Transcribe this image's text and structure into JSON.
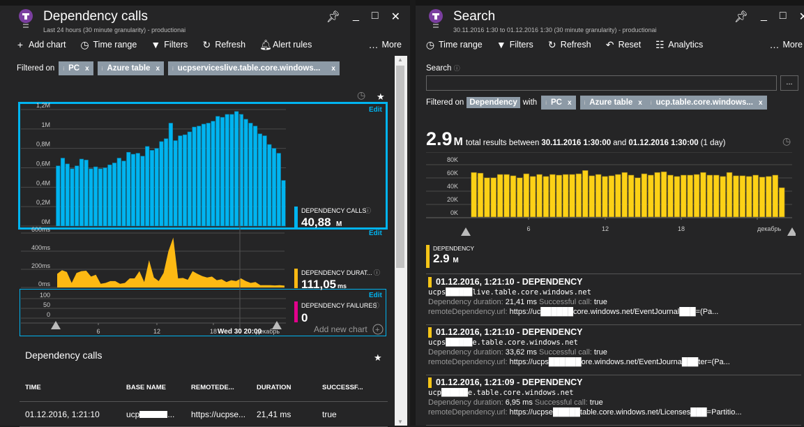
{
  "left": {
    "title": "Dependency calls",
    "subtitle": "Last 24 hours (30 minute granularity) - productionai",
    "toolbar": [
      "Add chart",
      "Time range",
      "Filters",
      "Refresh",
      "Alert rules"
    ],
    "more": "More",
    "filter_label": "Filtered on",
    "filters": [
      "PC",
      "Azure table",
      "ucpserviceslive.table.core.windows..."
    ],
    "edit": "Edit",
    "add_chart": "Add new chart",
    "metrics": [
      {
        "label": "DEPENDENCY CALLS",
        "value": "40,88",
        "unit": "M",
        "color": "#00b4f0"
      },
      {
        "label": "DEPENDENCY DURAT...",
        "value": "111,05",
        "unit": "ms",
        "color": "#fdb913"
      },
      {
        "label": "DEPENDENCY FAILURES",
        "value": "0",
        "unit": "",
        "color": "#e3008c"
      }
    ],
    "hover_label": "Wed 30 20:00",
    "section_title": "Dependency calls",
    "table": {
      "columns": [
        "TIME",
        "BASE NAME",
        "REMOTEDE...",
        "DURATION",
        "SUCCESSF..."
      ],
      "rows": [
        [
          "01.12.2016, 1:21:10",
          "ucp",
          "https://ucpse...",
          "21,41 ms",
          "true"
        ]
      ]
    }
  },
  "right": {
    "title": "Search",
    "subtitle": "30.11.2016 1:30 to 01.12.2016 1:30 (30 minute granularity) - productionai",
    "toolbar": [
      "Time range",
      "Filters",
      "Refresh",
      "Reset",
      "Analytics"
    ],
    "more": "More",
    "search_label": "Search",
    "search_value": "",
    "dots": "...",
    "filter_label": "Filtered on",
    "filter_type": "Dependency",
    "with": "with",
    "filters": [
      "PC",
      "Azure table",
      "ucp.table.core.windows..."
    ],
    "total_value": "2.9",
    "total_unit": "M",
    "total_text": "total results between",
    "from": "30.11.2016 1:30:00",
    "and": "and",
    "to": "01.12.2016 1:30:00",
    "span": "(1 day)",
    "summary": {
      "label": "DEPENDENCY",
      "value": "2.9",
      "unit": "M"
    },
    "results": [
      {
        "title": "01.12.2016, 1:21:10 - DEPENDENCY",
        "target": "ucps██████live.table.core.windows.net",
        "duration": "21,41 ms",
        "success": "true",
        "url": "https://uc██████core.windows.net/EventJournal███=(Pa..."
      },
      {
        "title": "01.12.2016, 1:21:10 - DEPENDENCY",
        "target": "ucps██████e.table.core.windows.net",
        "duration": "33,62 ms",
        "success": "true",
        "url": "https://ucps██████ore.windows.net/EventJourna███ter=(Pa..."
      },
      {
        "title": "01.12.2016, 1:21:09 - DEPENDENCY",
        "target": "ucp██████e.table.core.windows.net",
        "duration": "6,95 ms",
        "success": "true",
        "url": "https://ucpse█████table.core.windows.net/Licenses███=Partitio..."
      }
    ],
    "duration_key": "Dependency duration:",
    "success_key": "Successful call:",
    "url_key": "remoteDependency.url:"
  },
  "chart_data": [
    {
      "type": "bar",
      "title": "Dependency calls",
      "ylabel": "",
      "yticks": [
        "0M",
        "0,2M",
        "0,4M",
        "0,6M",
        "0,8M",
        "1M",
        "1,2M"
      ],
      "ylim": [
        0,
        1.2
      ],
      "xticks": [
        "6",
        "12",
        "18",
        "декабрь"
      ],
      "values": [
        0.62,
        0.7,
        0.64,
        0.59,
        0.62,
        0.69,
        0.68,
        0.59,
        0.61,
        0.59,
        0.6,
        0.63,
        0.65,
        0.7,
        0.67,
        0.76,
        0.74,
        0.75,
        0.72,
        0.82,
        0.78,
        0.8,
        0.87,
        0.9,
        1.06,
        0.88,
        0.93,
        0.94,
        0.97,
        1.02,
        1.03,
        1.05,
        1.06,
        1.08,
        1.13,
        1.12,
        1.15,
        1.15,
        1.18,
        1.15,
        1.1,
        1.06,
        1.03,
        0.95,
        0.93,
        0.84,
        0.8,
        0.75,
        0.47
      ]
    },
    {
      "type": "area",
      "title": "Dependency duration",
      "yticks": [
        "0ms",
        "200ms",
        "400ms",
        "600ms"
      ],
      "ylim": [
        0,
        600
      ],
      "values": [
        150,
        190,
        170,
        50,
        160,
        180,
        185,
        120,
        140,
        40,
        50,
        70,
        70,
        40,
        50,
        100,
        100,
        180,
        60,
        300,
        110,
        70,
        160,
        400,
        550,
        100,
        105,
        85,
        180,
        150,
        125,
        110,
        120,
        80,
        90,
        60,
        80,
        70,
        100,
        70,
        50,
        60,
        25,
        25,
        25,
        22,
        25,
        20
      ]
    },
    {
      "type": "line",
      "title": "Dependency failures",
      "yticks": [
        "0",
        "50",
        "100"
      ],
      "ylim": [
        0,
        100
      ],
      "values": []
    },
    {
      "type": "bar",
      "title": "Search results",
      "yticks": [
        "0K",
        "20K",
        "40K",
        "60K",
        "80K"
      ],
      "ylim": [
        0,
        80
      ],
      "xticks": [
        "6",
        "12",
        "18",
        "декабрь"
      ],
      "values": [
        64,
        63,
        56,
        56,
        61,
        61,
        59,
        56,
        62,
        58,
        61,
        58,
        61,
        60,
        61,
        61,
        62,
        67,
        59,
        61,
        58,
        59,
        61,
        64,
        60,
        56,
        62,
        60,
        64,
        65,
        60,
        58,
        60,
        60,
        61,
        64,
        60,
        60,
        58,
        64,
        59,
        59,
        58,
        60,
        57,
        58,
        60,
        41
      ]
    }
  ]
}
